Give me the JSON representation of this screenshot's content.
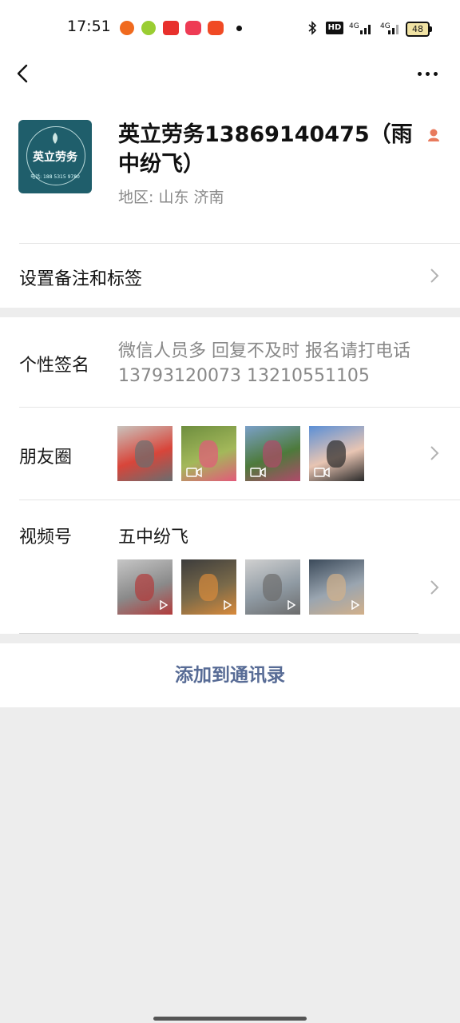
{
  "status_bar": {
    "time": "17:51",
    "battery": "48",
    "notification_icons": [
      "app-orange-icon",
      "app-lime-icon",
      "app-toutiao-icon",
      "app-shop-icon",
      "app-video-icon"
    ],
    "right_icons": [
      "bluetooth-icon",
      "hd-icon",
      "signal-4g-icon",
      "signal-4g-icon",
      "battery-icon"
    ]
  },
  "header": {
    "back_icon": "back-arrow-icon",
    "more_icon": "more-dots-icon"
  },
  "profile": {
    "avatar_text": "英立劳务",
    "avatar_subtext": "电话: 188 5315 9780",
    "name": "英立劳务13869140475（雨中纷飞）",
    "region": "地区:  山东  济南"
  },
  "remark": {
    "label": "设置备注和标签"
  },
  "signature": {
    "label": "个性签名",
    "text": "微信人员多 回复不及时 报名请打电话 13793120073   13210551105"
  },
  "moments": {
    "label": "朋友圈",
    "thumbs": [
      {
        "colors": [
          "#c9c3bd",
          "#d8453a",
          "#6a6d6f"
        ]
      },
      {
        "colors": [
          "#6e8e3f",
          "#a3b85a",
          "#e35a7a"
        ]
      },
      {
        "colors": [
          "#7aa0c8",
          "#4d7a3b",
          "#b04a6a"
        ]
      },
      {
        "colors": [
          "#5b8fd6",
          "#e8c5b3",
          "#2a2a2a"
        ]
      }
    ]
  },
  "channels": {
    "label": "视频号",
    "name": "五中纷飞",
    "thumbs": [
      {
        "colors": [
          "#c6c6c6",
          "#8a8a8a",
          "#b23b3b"
        ]
      },
      {
        "colors": [
          "#3c3c3c",
          "#7a6a4a",
          "#d98a3b"
        ]
      },
      {
        "colors": [
          "#d0d0d0",
          "#8f9aa3",
          "#6c6c6c"
        ]
      },
      {
        "colors": [
          "#3b4a5a",
          "#9aa5b0",
          "#d2b08a"
        ]
      }
    ]
  },
  "add_contact": {
    "label": "添加到通讯录"
  },
  "colors": {
    "link": "#576b95",
    "background": "#ededed",
    "secondary_text": "#888888"
  }
}
